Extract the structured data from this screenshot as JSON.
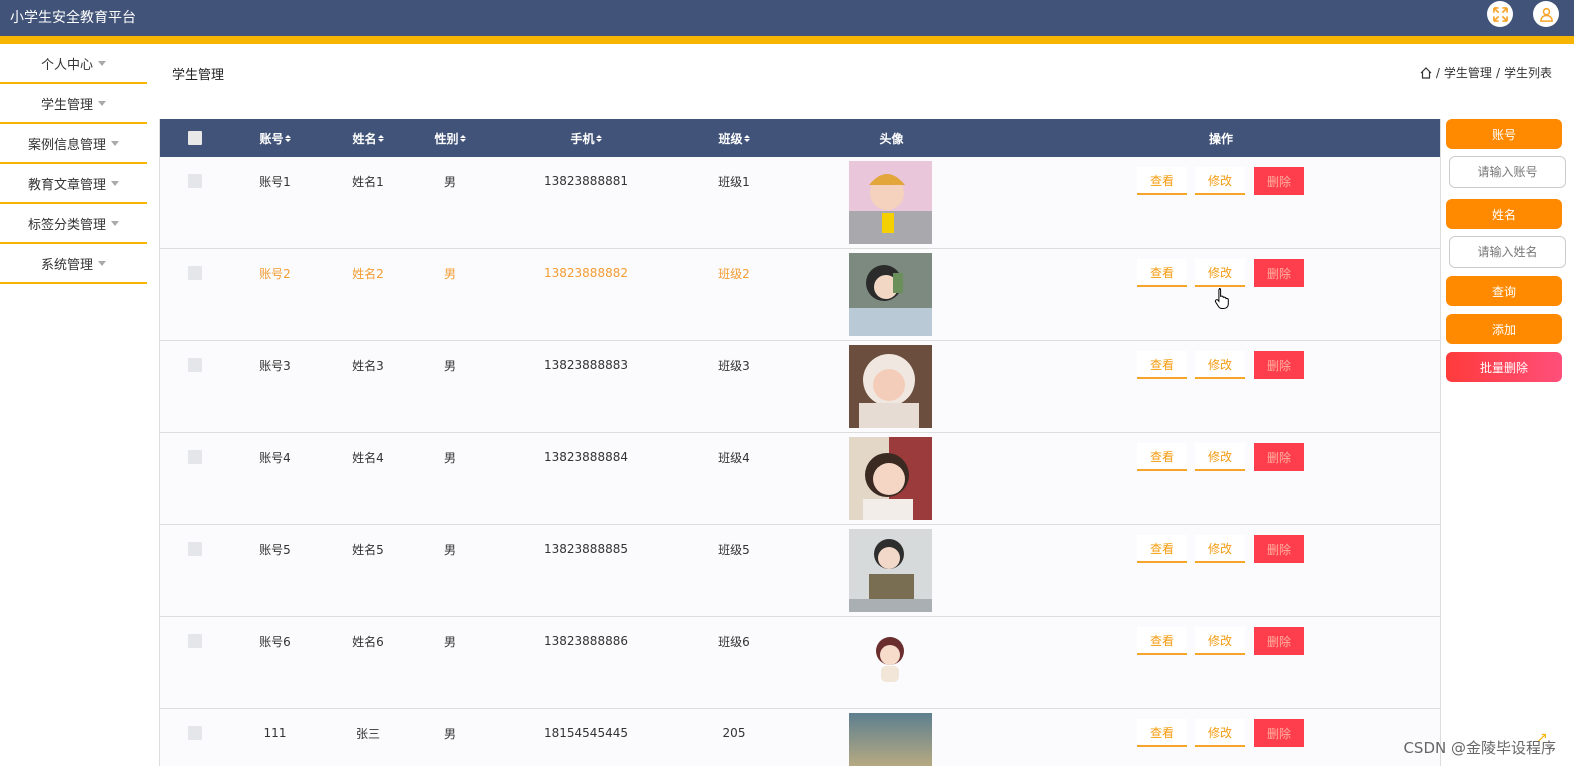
{
  "app": {
    "title": "小学生安全教育平台"
  },
  "sidebar": {
    "items": [
      {
        "label": "个人中心"
      },
      {
        "label": "学生管理"
      },
      {
        "label": "案例信息管理"
      },
      {
        "label": "教育文章管理"
      },
      {
        "label": "标签分类管理"
      },
      {
        "label": "系统管理"
      }
    ]
  },
  "page": {
    "title": "学生管理"
  },
  "breadcrumb": {
    "items": [
      "/",
      "学生管理",
      "/",
      "学生列表"
    ]
  },
  "table": {
    "headers": {
      "account": "账号",
      "name": "姓名",
      "gender": "性别",
      "phone": "手机",
      "class": "班级",
      "avatar": "头像",
      "actions": "操作"
    },
    "rows": [
      {
        "account": "账号1",
        "name": "姓名1",
        "gender": "男",
        "phone": "13823888881",
        "class": "班级1"
      },
      {
        "account": "账号2",
        "name": "姓名2",
        "gender": "男",
        "phone": "13823888882",
        "class": "班级2"
      },
      {
        "account": "账号3",
        "name": "姓名3",
        "gender": "男",
        "phone": "13823888883",
        "class": "班级3"
      },
      {
        "account": "账号4",
        "name": "姓名4",
        "gender": "男",
        "phone": "13823888884",
        "class": "班级4"
      },
      {
        "account": "账号5",
        "name": "姓名5",
        "gender": "男",
        "phone": "13823888885",
        "class": "班级5"
      },
      {
        "account": "账号6",
        "name": "姓名6",
        "gender": "男",
        "phone": "13823888886",
        "class": "班级6"
      },
      {
        "account": "111",
        "name": "张三",
        "gender": "男",
        "phone": "18154545445",
        "class": "205"
      }
    ],
    "actions": {
      "view": "查看",
      "edit": "修改",
      "delete": "删除"
    }
  },
  "search": {
    "account_label": "账号",
    "account_placeholder": "请输入账号",
    "name_label": "姓名",
    "name_placeholder": "请输入姓名",
    "query": "查询",
    "add": "添加",
    "batch_delete": "批量删除"
  },
  "watermark": "CSDN @金陵毕设程序",
  "icons": {
    "fullscreen": "fullscreen-icon",
    "user": "user-icon",
    "home": "home-icon"
  },
  "colors": {
    "header": "#415378",
    "accent": "#f7b500",
    "orange": "#ff8a00",
    "danger": "#ff3e4d"
  }
}
